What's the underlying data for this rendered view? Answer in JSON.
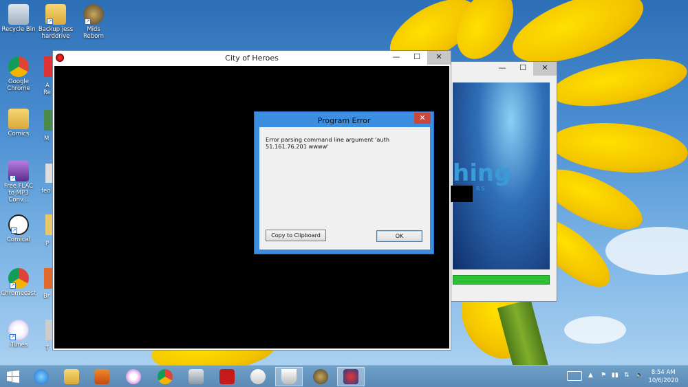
{
  "desktop_icons": [
    {
      "label": "Recycle Bin",
      "icon": "recycle-bin-icon"
    },
    {
      "label": "Backup jess harddrive",
      "icon": "folder-icon"
    },
    {
      "label": "Mids Reborn",
      "icon": "mids-reborn-icon"
    },
    {
      "label": "Google Chrome",
      "icon": "chrome-icon"
    },
    {
      "label": "Comics",
      "icon": "folder-icon"
    },
    {
      "label": "Free FLAC to MP3 Conv...",
      "icon": "flac-converter-icon"
    },
    {
      "label": "Comical",
      "icon": "comical-icon"
    },
    {
      "label": "Chromecast",
      "icon": "chromecast-icon"
    },
    {
      "label": "iTunes",
      "icon": "itunes-icon"
    }
  ],
  "partial_labels": [
    "A",
    "Re",
    "M",
    "feo",
    "P",
    "Br",
    "T"
  ],
  "coh_window": {
    "title": "City of Heroes",
    "minimize": "—",
    "maximize": "☐",
    "close": "✕"
  },
  "launcher_window": {
    "minimize": "—",
    "maximize": "☐",
    "close": "✕",
    "logo_text": "hing",
    "logo_sub": "RS"
  },
  "error_dialog": {
    "title": "Program Error",
    "close": "✕",
    "message": "Error parsing command line argument 'auth 51.161.76.201 wwww'",
    "copy_button": "Copy to Clipboard",
    "ok_button": "OK"
  },
  "taskbar": {
    "items": [
      {
        "name": "start-button",
        "icon": "windows-start-icon"
      },
      {
        "name": "internet-explorer",
        "icon": "ie-icon"
      },
      {
        "name": "file-explorer",
        "icon": "file-explorer-icon"
      },
      {
        "name": "media-player",
        "icon": "media-player-icon"
      },
      {
        "name": "itunes",
        "icon": "itunes-icon"
      },
      {
        "name": "chrome",
        "icon": "chrome-icon"
      },
      {
        "name": "scanner",
        "icon": "scanner-icon"
      },
      {
        "name": "acrobat",
        "icon": "acrobat-icon"
      },
      {
        "name": "foobar",
        "icon": "foobar-icon"
      },
      {
        "name": "cup-app",
        "icon": "cup-icon"
      },
      {
        "name": "mids-reborn",
        "icon": "mids-reborn-icon"
      },
      {
        "name": "city-of-heroes",
        "icon": "city-of-heroes-icon"
      }
    ],
    "clock_time": "8:54 AM",
    "clock_date": "10/6/2020"
  }
}
